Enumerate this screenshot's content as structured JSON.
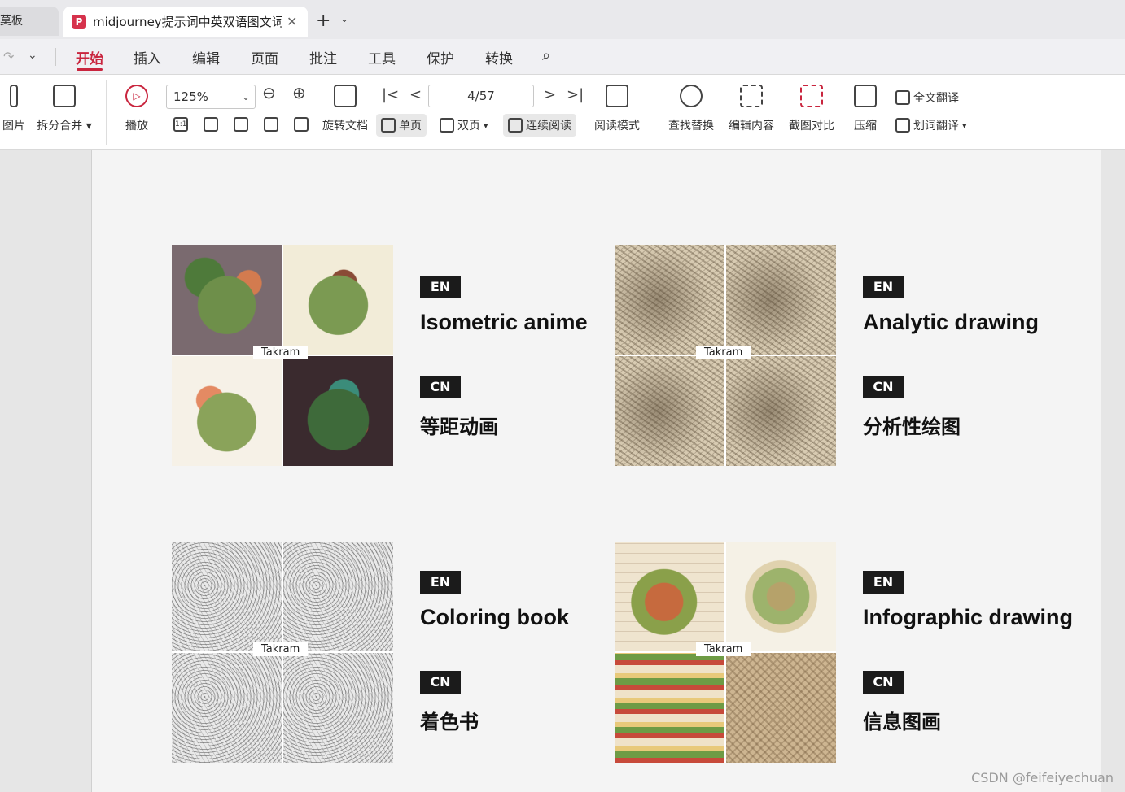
{
  "tabs": {
    "inactive_label": "莫板",
    "active_title": "midjourney提示词中英双语图文词",
    "logo_glyph": "P",
    "close_glyph": "✕",
    "add_glyph": "+",
    "add_caret": "⌄"
  },
  "menu": {
    "undo_glyph": "↷",
    "caret_glyph": "⌄",
    "items": [
      "开始",
      "插入",
      "编辑",
      "页面",
      "批注",
      "工具",
      "保护",
      "转换"
    ],
    "active_index": 0,
    "search_glyph": "⌕"
  },
  "toolbar": {
    "img_label": "图片",
    "split_merge_label": "拆分合并",
    "play_label": "播放",
    "zoom_value": "125%",
    "rotate_doc_label": "旋转文档",
    "single_page_label": "单页",
    "double_page_label": "双页",
    "continuous_label": "连续阅读",
    "page_indicator": "4/57",
    "read_mode_label": "阅读模式",
    "find_replace_label": "查找替换",
    "edit_content_label": "编辑内容",
    "screenshot_compare_label": "截图对比",
    "compress_label": "压缩",
    "full_translate_label": "全文翻译",
    "word_translate_label": "划词翻译",
    "actual_size_glyph": "1:1",
    "first_glyph": "|<",
    "prev_glyph": "<",
    "next_glyph": ">",
    "last_glyph": ">|",
    "zoom_out_glyph": "⊖",
    "zoom_in_glyph": "⊕"
  },
  "cards": [
    {
      "badge_en": "EN",
      "badge_cn": "CN",
      "en": "Isometric anime",
      "cn": "等距动画",
      "watermark": "Takram",
      "style": [
        "iso1",
        "iso2",
        "iso3",
        "iso4"
      ]
    },
    {
      "badge_en": "EN",
      "badge_cn": "CN",
      "en": "Analytic drawing",
      "cn": "分析性绘图",
      "watermark": "Takram",
      "style": [
        "sketch",
        "sketch",
        "sketch",
        "sketch"
      ]
    },
    {
      "badge_en": "EN",
      "badge_cn": "CN",
      "en": "Coloring book",
      "cn": "着色书",
      "watermark": "Takram",
      "style": [
        "lineart",
        "lineart",
        "lineart",
        "lineart"
      ]
    },
    {
      "badge_en": "EN",
      "badge_cn": "CN",
      "en": "Infographic drawing",
      "cn": "信息图画",
      "watermark": "Takram",
      "style": [
        "info1",
        "info2",
        "info3",
        "info4"
      ]
    }
  ],
  "watermark_text": "CSDN @feifeiyechuan",
  "colors": {
    "accent": "#c9253e",
    "badge_bg": "#1b1b1b",
    "page_bg": "#f4f4f4"
  }
}
